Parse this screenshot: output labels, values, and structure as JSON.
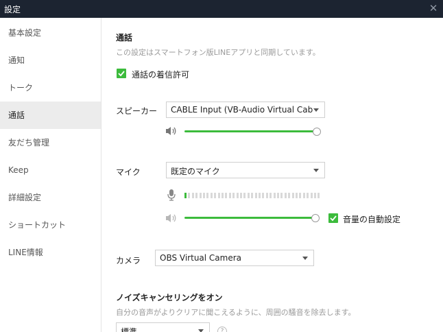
{
  "window": {
    "title": "設定",
    "close_glyph": "✕"
  },
  "sidebar": {
    "items": [
      {
        "label": "基本設定",
        "active": false
      },
      {
        "label": "通知",
        "active": false
      },
      {
        "label": "トーク",
        "active": false
      },
      {
        "label": "通話",
        "active": true
      },
      {
        "label": "友だち管理",
        "active": false
      },
      {
        "label": "Keep",
        "active": false
      },
      {
        "label": "詳細設定",
        "active": false
      },
      {
        "label": "ショートカット",
        "active": false
      },
      {
        "label": "LINE情報",
        "active": false
      }
    ]
  },
  "call": {
    "title": "通話",
    "description": "この設定はスマートフォン版LINEアプリと同期しています。",
    "allow_incoming": {
      "label": "通話の着信許可",
      "checked": true
    }
  },
  "speaker": {
    "label": "スピーカー",
    "selected": "CABLE Input (VB-Audio Virtual Cab…",
    "volume": 1.0,
    "icon": "speaker-icon"
  },
  "mic": {
    "label": "マイク",
    "selected": "既定のマイク",
    "level": 0.03,
    "volume": 1.0,
    "icon": "microphone-icon",
    "auto_volume": {
      "label": "音量の自動設定",
      "checked": true
    }
  },
  "camera": {
    "label": "カメラ",
    "selected": "OBS Virtual Camera"
  },
  "noise": {
    "title": "ノイズキャンセリングをオン",
    "description": "自分の音声がよりクリアに聞こえるように、周囲の騒音を除去します。",
    "selected": "標準",
    "help_glyph": "?"
  },
  "colors": {
    "accent": "#3cbb3c",
    "titlebar": "#1c2431",
    "active_item": "#ececec"
  }
}
